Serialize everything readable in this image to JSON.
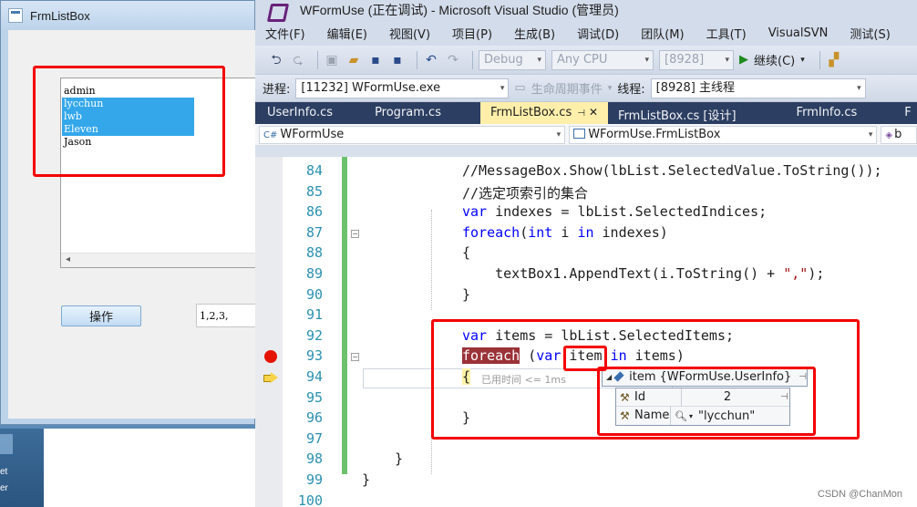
{
  "form_window": {
    "title": "FrmListBox",
    "listbox": {
      "items": [
        {
          "text": "admin",
          "selected": false
        },
        {
          "text": "lycchun",
          "selected": true
        },
        {
          "text": "lwb",
          "selected": true
        },
        {
          "text": "Eleven",
          "selected": true
        },
        {
          "text": "Jason",
          "selected": false
        }
      ],
      "scroll_arrow": "◂"
    },
    "button_label": "操作",
    "textbox_value": "1,2,3,"
  },
  "desktop": {
    "text_1": "et",
    "text_2": "er"
  },
  "vs": {
    "title": "WFormUse (正在调试) - Microsoft Visual Studio (管理员)",
    "menu": [
      "文件(F)",
      "编辑(E)",
      "视图(V)",
      "项目(P)",
      "生成(B)",
      "调试(D)",
      "团队(M)",
      "工具(T)",
      "VisualSVN",
      "测试(S)"
    ],
    "toolbar": {
      "config": "Debug",
      "platform": "Any CPU",
      "process_id": "[8928]",
      "continue_label": "继续(C)"
    },
    "debugbar": {
      "process_label": "进程:",
      "process_value": "[11232] WFormUse.exe",
      "lifecycle_label": "生命周期事件",
      "thread_label": "线程:",
      "thread_value": "[8928] 主线程"
    },
    "tabs": [
      "UserInfo.cs",
      "Program.cs",
      "FrmListBox.cs",
      "FrmListBox.cs [设计]",
      "FrmInfo.cs",
      "F"
    ],
    "active_tab_index": 2,
    "nav": {
      "project": "WFormUse",
      "class": "WFormUse.FrmListBox",
      "member": "b"
    },
    "editor": {
      "lines": [
        {
          "n": "84",
          "code": "//MessageBox.Show(lbList.SelectedValue.ToString());"
        },
        {
          "n": "85",
          "code": "//选定项索引的集合"
        },
        {
          "n": "86",
          "code": "var indexes = lbList.SelectedIndices;"
        },
        {
          "n": "87",
          "code": "foreach(int i in indexes)"
        },
        {
          "n": "88",
          "code": "{"
        },
        {
          "n": "89",
          "code": "    textBox1.AppendText(i.ToString() + \",\");"
        },
        {
          "n": "90",
          "code": "}"
        },
        {
          "n": "91",
          "code": ""
        },
        {
          "n": "92",
          "code": "var items = lbList.SelectedItems;"
        },
        {
          "n": "93",
          "code": "foreach (var item in items)"
        },
        {
          "n": "94",
          "code": "{"
        },
        {
          "n": "95",
          "code": ""
        },
        {
          "n": "96",
          "code": "}"
        },
        {
          "n": "97",
          "code": "}"
        },
        {
          "n": "98",
          "code": "}"
        },
        {
          "n": "99",
          "code": "}"
        },
        {
          "n": "100",
          "code": ""
        }
      ],
      "elapsed": "已用时间 <= 1ms"
    },
    "datatip": {
      "name": "item",
      "value": "{WFormUse.UserInfo}",
      "fields": [
        {
          "name": "Id",
          "value": "2"
        },
        {
          "name": "Name",
          "value": "\"lycchun\""
        }
      ]
    }
  },
  "watermark": "CSDN @ChanMon",
  "colors": {
    "selection": "#33a7ea",
    "annotation_red": "#f40000",
    "active_tab": "#ffefab",
    "tab_strip": "#2c3e61",
    "breakpoint": "#e51400",
    "keyword": "#0000ff",
    "comment": "#008000"
  }
}
